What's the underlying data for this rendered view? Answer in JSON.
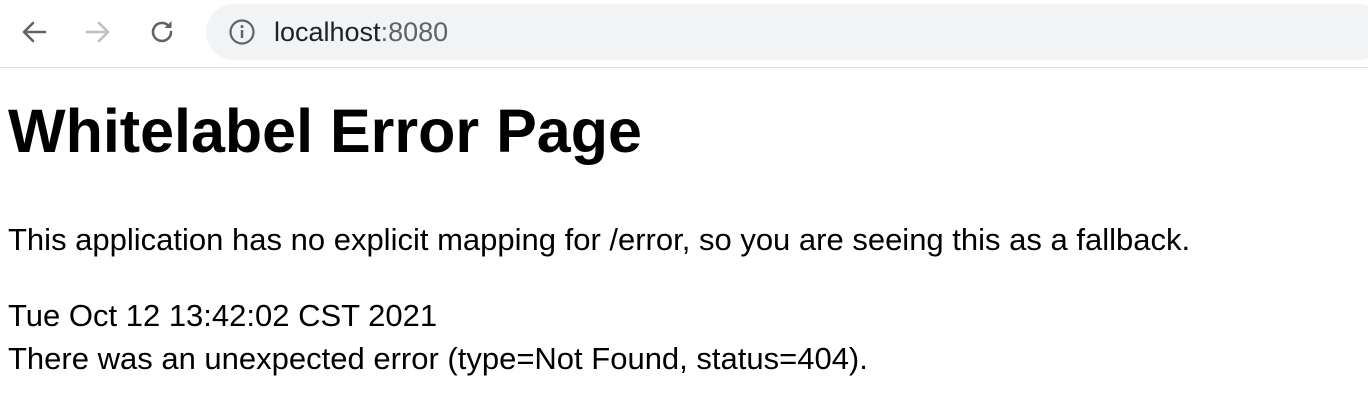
{
  "browser": {
    "url_host": "localhost",
    "url_port": ":8080"
  },
  "page": {
    "heading": "Whitelabel Error Page",
    "message": "This application has no explicit mapping for /error, so you are seeing this as a fallback.",
    "timestamp": "Tue Oct 12 13:42:02 CST 2021",
    "error_detail": "There was an unexpected error (type=Not Found, status=404)."
  }
}
